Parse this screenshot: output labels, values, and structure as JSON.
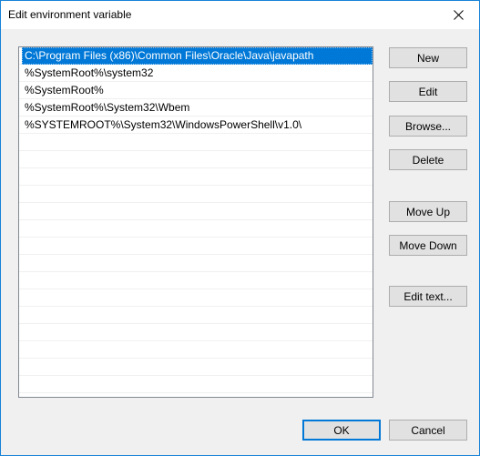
{
  "window": {
    "title": "Edit environment variable",
    "close_icon": "close-icon"
  },
  "path_list": {
    "items": [
      {
        "text": "C:\\Program Files (x86)\\Common Files\\Oracle\\Java\\javapath",
        "selected": true
      },
      {
        "text": "%SystemRoot%\\system32",
        "selected": false
      },
      {
        "text": "%SystemRoot%",
        "selected": false
      },
      {
        "text": "%SystemRoot%\\System32\\Wbem",
        "selected": false
      },
      {
        "text": "%SYSTEMROOT%\\System32\\WindowsPowerShell\\v1.0\\",
        "selected": false
      }
    ]
  },
  "buttons": {
    "new": "New",
    "edit": "Edit",
    "browse": "Browse...",
    "delete": "Delete",
    "move_up": "Move Up",
    "move_down": "Move Down",
    "edit_text": "Edit text...",
    "ok": "OK",
    "cancel": "Cancel"
  },
  "colors": {
    "selection": "#0078d7",
    "window_border": "#1883d7",
    "dialog_bg": "#f0f0f0"
  }
}
